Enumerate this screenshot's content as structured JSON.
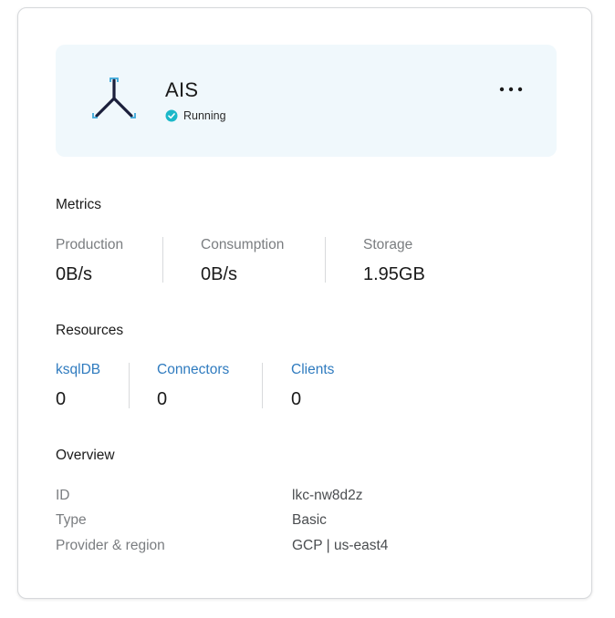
{
  "cluster": {
    "name": "AIS",
    "status": "Running",
    "more_label": "•••",
    "status_color": "#1bb8c9",
    "logo_icon": "three-node-cluster-icon"
  },
  "metrics": {
    "title": "Metrics",
    "items": [
      {
        "label": "Production",
        "value": "0B/s"
      },
      {
        "label": "Consumption",
        "value": "0B/s"
      },
      {
        "label": "Storage",
        "value": "1.95GB"
      }
    ]
  },
  "resources": {
    "title": "Resources",
    "items": [
      {
        "label": "ksqlDB",
        "value": "0"
      },
      {
        "label": "Connectors",
        "value": "0"
      },
      {
        "label": "Clients",
        "value": "0"
      }
    ]
  },
  "overview": {
    "title": "Overview",
    "rows": [
      {
        "label": "ID",
        "value": "lkc-nw8d2z"
      },
      {
        "label": "Type",
        "value": "Basic"
      },
      {
        "label": "Provider & region",
        "value": "GCP | us-east4"
      }
    ]
  },
  "colors": {
    "link": "#2f7bbf",
    "header_bg": "#f0f8fc",
    "muted_text": "#7a7d80"
  }
}
